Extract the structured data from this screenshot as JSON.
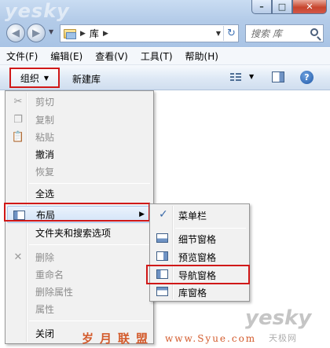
{
  "window": {
    "watermark_top": "yesky",
    "ghost_menu": [
      "",
      "",
      ""
    ],
    "buttons": {
      "minimize": "–",
      "maximize": "□",
      "close": "✕"
    }
  },
  "address": {
    "crumb": "库",
    "search_placeholder": "搜索 库"
  },
  "menubar": {
    "items": [
      "文件(F)",
      "编辑(E)",
      "查看(V)",
      "工具(T)",
      "帮助(H)"
    ]
  },
  "toolbar": {
    "organize_label": "组织",
    "new_library_label": "新建库"
  },
  "organize_menu": {
    "items": [
      {
        "label": "剪切",
        "enabled": false,
        "icon": "scissors-icon"
      },
      {
        "label": "复制",
        "enabled": false,
        "icon": "copy-icon"
      },
      {
        "label": "粘贴",
        "enabled": false,
        "icon": "paste-icon"
      },
      {
        "label": "撤消",
        "enabled": true
      },
      {
        "label": "恢复",
        "enabled": false
      },
      {
        "label": "全选",
        "enabled": true
      },
      {
        "label": "布局",
        "enabled": true,
        "icon": "layout-icon",
        "submenu": true
      },
      {
        "label": "文件夹和搜索选项",
        "enabled": true
      },
      {
        "label": "删除",
        "enabled": false,
        "icon": "delete-icon"
      },
      {
        "label": "重命名",
        "enabled": false
      },
      {
        "label": "删除属性",
        "enabled": false
      },
      {
        "label": "属性",
        "enabled": false
      },
      {
        "label": "关闭",
        "enabled": true
      }
    ]
  },
  "layout_submenu": {
    "items": [
      {
        "label": "菜单栏",
        "checked": true
      },
      {
        "label": "细节窗格",
        "icon": "details-pane-icon"
      },
      {
        "label": "预览窗格",
        "icon": "preview-pane-icon"
      },
      {
        "label": "导航窗格",
        "icon": "navigation-pane-icon"
      },
      {
        "label": "库窗格",
        "icon": "library-pane-icon"
      }
    ]
  },
  "watermarks": {
    "bottom_text": "岁月联盟",
    "url": "www.Syue.com",
    "yesky": "yesky",
    "yesky_sub": "天极网"
  },
  "colors": {
    "highlight_border": "#d01818",
    "menu_bg": "#f1f1f1",
    "toolbar_top": "#f7fafd",
    "chrome": "#b3cbe8"
  }
}
